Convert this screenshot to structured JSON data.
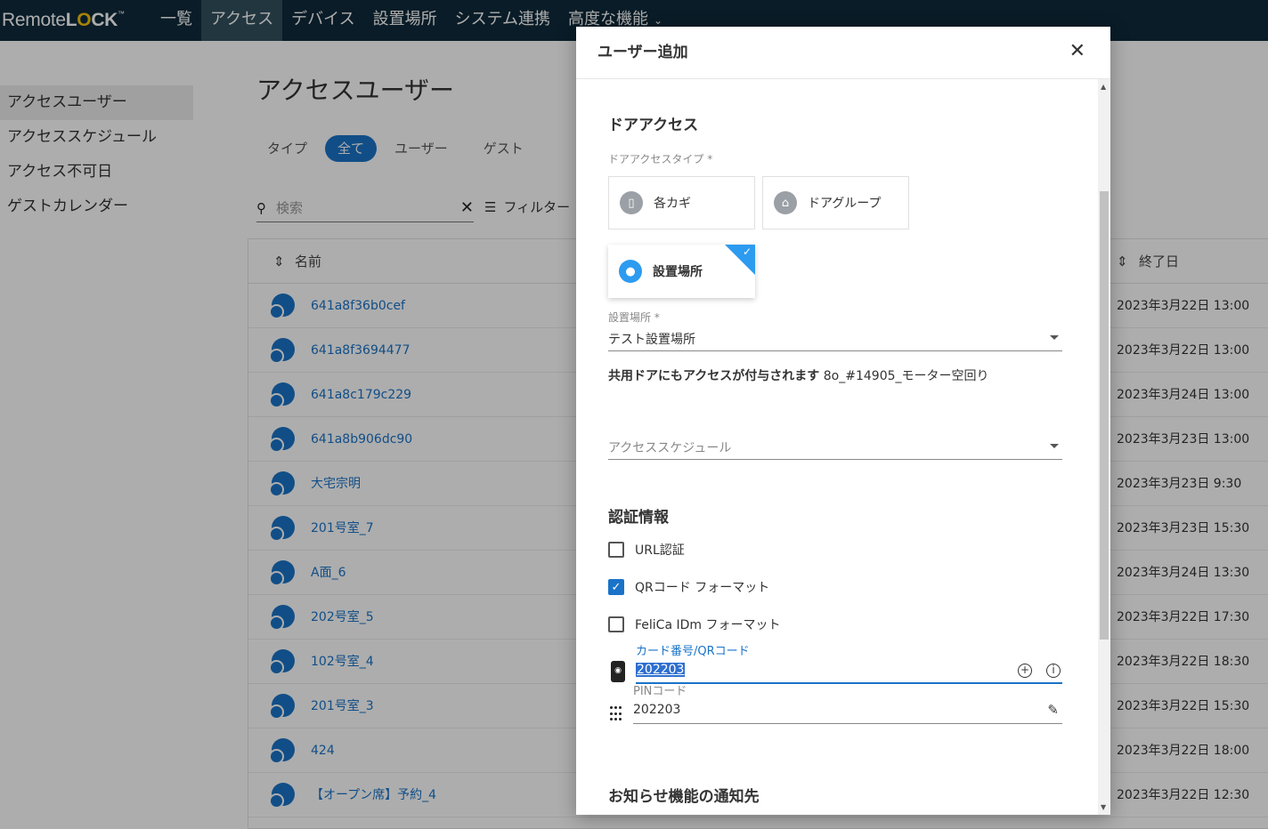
{
  "app": {
    "logo_text_a": "Remote",
    "logo_text_b": "L",
    "logo_text_o": "O",
    "logo_text_c": "CK",
    "logo_tm": "™"
  },
  "nav": {
    "items": [
      {
        "label": "一覧"
      },
      {
        "label": "アクセス",
        "active": true
      },
      {
        "label": "デバイス"
      },
      {
        "label": "設置場所"
      },
      {
        "label": "システム連携"
      },
      {
        "label": "高度な機能"
      }
    ]
  },
  "sidebar": {
    "items": [
      {
        "label": "アクセスユーザー",
        "active": true
      },
      {
        "label": "アクセススケジュール"
      },
      {
        "label": "アクセス不可日"
      },
      {
        "label": "ゲストカレンダー"
      }
    ]
  },
  "main": {
    "title": "アクセスユーザー",
    "type_label": "タイプ",
    "chips": [
      "全て",
      "ユーザー",
      "ゲスト"
    ],
    "search_placeholder": "検索",
    "filter_label": "フィルター",
    "columns": {
      "name": "名前",
      "end": "終了日"
    },
    "rows": [
      {
        "name": "641a8f36b0cef",
        "end": "2023年3月22日 13:00"
      },
      {
        "name": "641a8f3694477",
        "end": "2023年3月22日 13:00"
      },
      {
        "name": "641a8c179c229",
        "end": "2023年3月24日 13:00"
      },
      {
        "name": "641a8b906dc90",
        "end": "2023年3月23日 13:00"
      },
      {
        "name": "大宅宗明",
        "end": "2023年3月23日 9:30"
      },
      {
        "name": "201号室_7",
        "end": "2023年3月23日 15:30"
      },
      {
        "name": "A面_6",
        "end": "2023年3月24日 13:30"
      },
      {
        "name": "202号室_5",
        "end": "2023年3月22日 17:30"
      },
      {
        "name": "102号室_4",
        "end": "2023年3月22日 18:30"
      },
      {
        "name": "201号室_3",
        "end": "2023年3月22日 15:30"
      },
      {
        "name": "424",
        "end": "2023年3月22日 18:00"
      },
      {
        "name": "【オープン席】予約_4",
        "end": "2023年3月22日 12:30"
      }
    ]
  },
  "dialog": {
    "title": "ユーザー追加",
    "door_access_title": "ドアアクセス",
    "door_access_type_label": "ドアアクセスタイプ *",
    "door_types": [
      {
        "label": "各カギ",
        "icon": "lock-icon"
      },
      {
        "label": "ドアグループ",
        "icon": "door-group-icon"
      },
      {
        "label": "設置場所",
        "icon": "location-pin-icon",
        "selected": true
      }
    ],
    "location_label": "設置場所 *",
    "location_value": "テスト設置場所",
    "shared_note_bold": "共用ドアにもアクセスが付与されます",
    "shared_note_value": "8o_#14905_モーター空回り",
    "schedule_placeholder": "アクセススケジュール",
    "auth_title": "認証情報",
    "checkboxes": [
      {
        "label": "URL認証",
        "checked": false
      },
      {
        "label": "QRコード フォーマット",
        "checked": true
      },
      {
        "label": "FeliCa IDm フォーマット",
        "checked": false
      }
    ],
    "card_label": "カード番号/QRコード",
    "card_value": "202203",
    "pin_label": "PINコード",
    "pin_value": "202203",
    "notify_title": "お知らせ機能の通知先"
  }
}
